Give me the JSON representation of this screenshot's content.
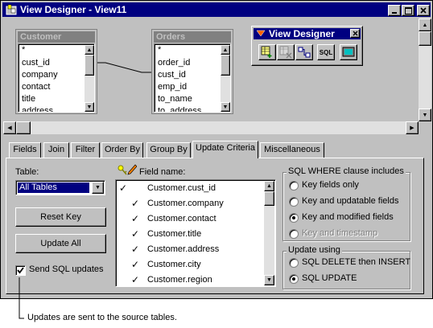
{
  "window": {
    "title": "View Designer - View11"
  },
  "tables": [
    {
      "name": "Customer",
      "fields": [
        "*",
        "cust_id",
        "company",
        "contact",
        "title",
        "address"
      ]
    },
    {
      "name": "Orders",
      "fields": [
        "*",
        "order_id",
        "cust_id",
        "emp_id",
        "to_name",
        "to_address"
      ]
    }
  ],
  "toolbar": {
    "title": "View Designer",
    "sql_label": "SQL"
  },
  "tabs": [
    "Fields",
    "Join",
    "Filter",
    "Order By",
    "Group By",
    "Update Criteria",
    "Miscellaneous"
  ],
  "table_select": {
    "label": "Table:",
    "value": "All Tables"
  },
  "buttons": {
    "reset_key": "Reset Key",
    "update_all": "Update All"
  },
  "send_sql": {
    "label": "Send SQL updates",
    "checked": true
  },
  "field_name_label": "Field name:",
  "field_rows": [
    {
      "key": true,
      "upd": false,
      "name": "Customer.cust_id"
    },
    {
      "key": false,
      "upd": true,
      "name": "Customer.company"
    },
    {
      "key": false,
      "upd": true,
      "name": "Customer.contact"
    },
    {
      "key": false,
      "upd": true,
      "name": "Customer.title"
    },
    {
      "key": false,
      "upd": true,
      "name": "Customer.address"
    },
    {
      "key": false,
      "upd": true,
      "name": "Customer.city"
    },
    {
      "key": false,
      "upd": true,
      "name": "Customer.region"
    }
  ],
  "where_group": {
    "title": "SQL WHERE clause includes",
    "options": [
      "Key fields only",
      "Key and updatable fields",
      "Key and modified fields",
      "Key and timestamp"
    ],
    "selected": 2
  },
  "update_group": {
    "title": "Update using",
    "options": [
      "SQL DELETE then INSERT",
      "SQL UPDATE"
    ],
    "selected": 1
  },
  "callout": "Updates are sent to the source tables."
}
